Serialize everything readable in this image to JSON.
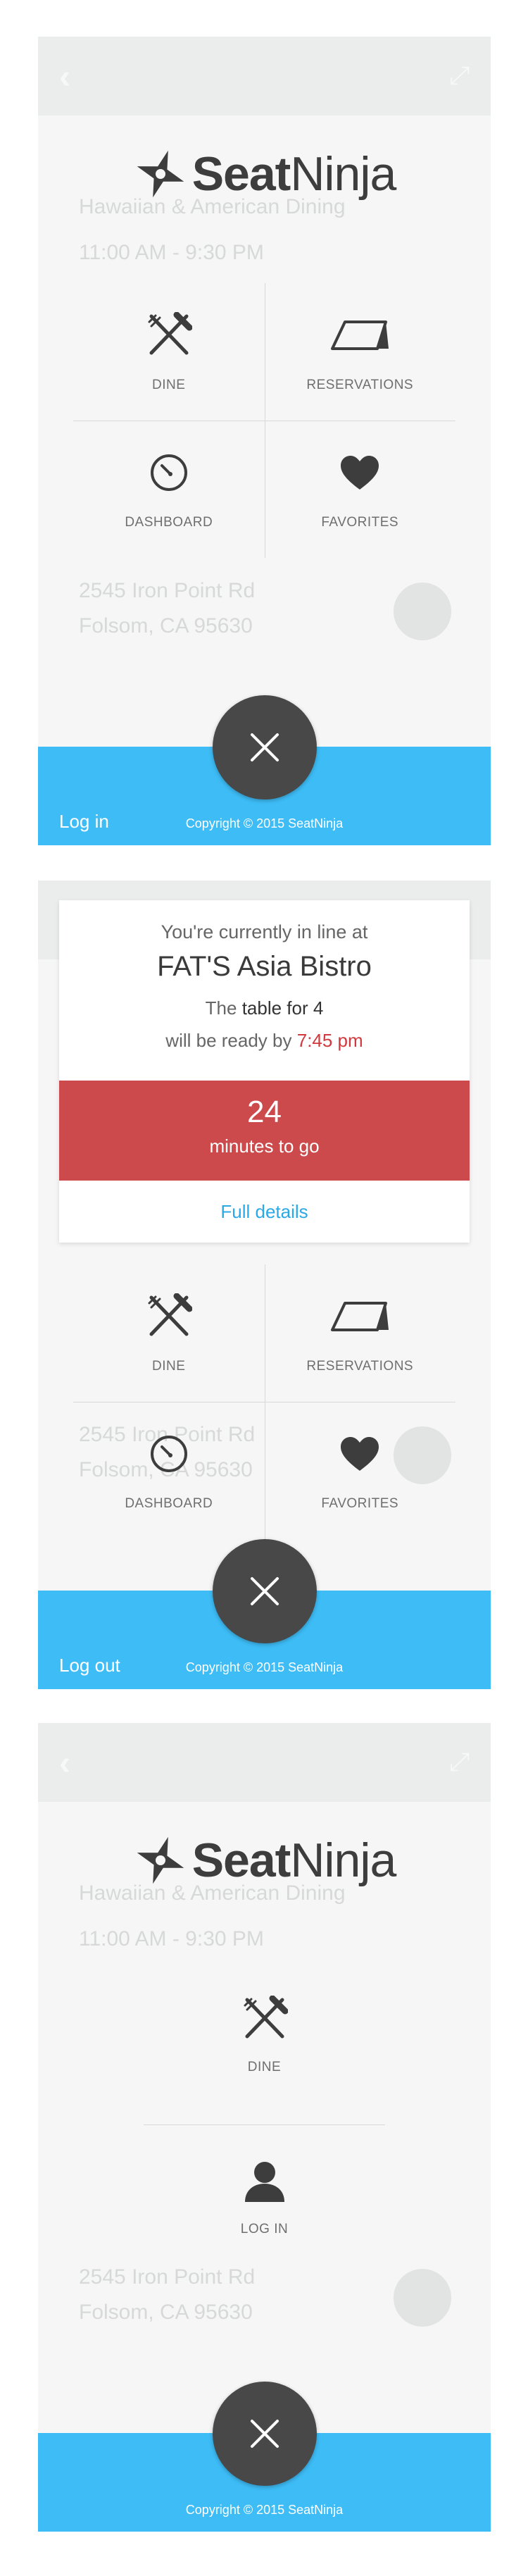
{
  "brand": {
    "name_bold": "Seat",
    "name_light": "Ninja"
  },
  "menu": {
    "dine": "DINE",
    "reservations": "RESERVATIONS",
    "dashboard": "DASHBOARD",
    "favorites": "FAVORITES",
    "login": "LOG IN"
  },
  "footer": {
    "login_label": "Log in",
    "logout_label": "Log out",
    "copyright": "Copyright © 2015 SeatNinja"
  },
  "queue_card": {
    "intro": "You're currently in line at",
    "restaurant": "FAT'S Asia Bistro",
    "table_prefix": "The",
    "table": "table for 4",
    "ready_prefix": "will be ready by",
    "ready_time": "7:45 pm",
    "minutes": "24",
    "minutes_label": "minutes to go",
    "details_link": "Full details"
  },
  "background": {
    "address_street": "2545 Iron Point Rd",
    "address_city": "Folsom, CA 95630",
    "cuisine": "Hawaiian & American Dining",
    "hours": "11:00 AM - 9:30 PM"
  },
  "colors": {
    "accent_blue": "#3dbcf6",
    "alert_red": "#cc4a4b",
    "close_button": "#484848"
  },
  "icons": [
    "fork-knife-icon",
    "reservation-tent-icon",
    "speedometer-icon",
    "heart-icon",
    "user-icon",
    "close-icon",
    "ninja-star-icon"
  ]
}
